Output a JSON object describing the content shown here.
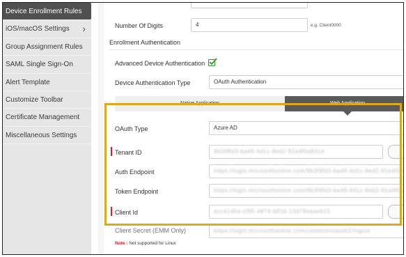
{
  "sidebar": {
    "items": [
      {
        "label": "Device Enrollment Rules",
        "active": true
      },
      {
        "label": "iOS/macOS Settings",
        "has_submenu": true
      },
      {
        "label": "Group Assignment Rules"
      },
      {
        "label": "SAML Single Sign-On"
      },
      {
        "label": "Alert Template"
      },
      {
        "label": "Customize Toolbar"
      },
      {
        "label": "Certificate Management"
      },
      {
        "label": "Miscellaneous Settings"
      }
    ]
  },
  "form": {
    "number_of_digits_label": "Number Of Digits",
    "number_of_digits_value": "4",
    "number_of_digits_hint": "e.g. Client0000",
    "section_title": "Enrollment Authentication",
    "advanced_auth_label": "Advanced Device Authentication",
    "advanced_auth_checked": true,
    "auth_type_label": "Device Authentication Type",
    "auth_type_value": "OAuth Authentication"
  },
  "tabs": [
    {
      "label": "Native Application",
      "active": false
    },
    {
      "label": "Web Application",
      "active": true
    }
  ],
  "oauth": {
    "type_label": "OAuth Type",
    "type_value": "Azure AD",
    "tenant_label": "Tenant ID",
    "tenant_value": "9b3f9fd3-ba49-4d1c-8ed2-91a4f0a8314",
    "auth_endpoint_label": "Auth Endpoint",
    "auth_endpoint_value": "https://login.microsoftonline.com/9b3f9fd3-ba49-4d1c-8ed2-91a4f0a8314/oauth2",
    "token_endpoint_label": "Token Endpoint",
    "token_endpoint_value": "https://login.microsoftonline.com/9b3f9fd3-ba49-4d1c-8ed2-91a4f0a8314/oauth2",
    "client_id_label": "Client Id",
    "client_id_value": "acc41d0a-cf95-4874-b81b-13d78eaaeb15",
    "client_secret_label": "Client Secret (EMM Only)",
    "client_secret_value": "https://login.microsoftonline.com/common/oauth2/logout"
  },
  "note": {
    "prefix": "Note :",
    "text": "Not supported for Linux"
  },
  "colors": {
    "sidebar_active": "#505050",
    "highlight": "#d9a91f",
    "required": "#d02030",
    "check": "#2d9c2d"
  }
}
